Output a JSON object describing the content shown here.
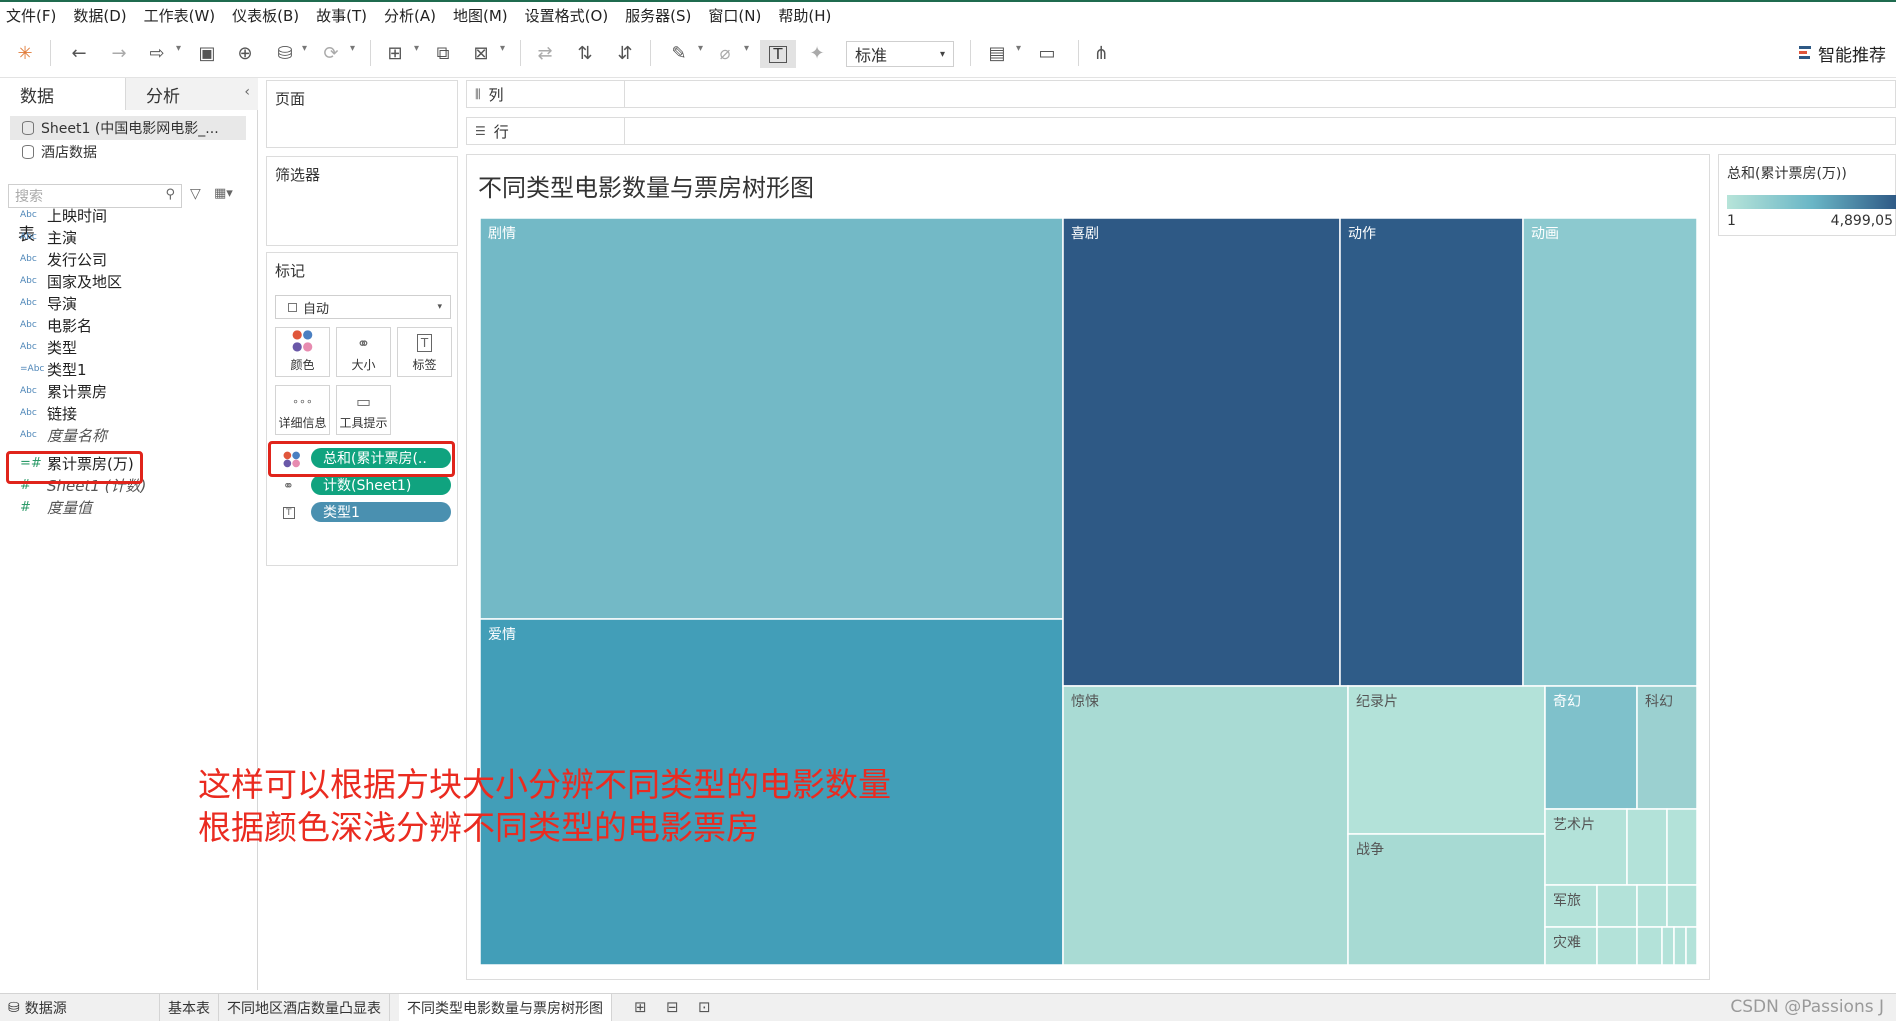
{
  "menu": [
    "文件(F)",
    "数据(D)",
    "工作表(W)",
    "仪表板(B)",
    "故事(T)",
    "分析(A)",
    "地图(M)",
    "设置格式(O)",
    "服务器(S)",
    "窗口(N)",
    "帮助(H)"
  ],
  "toolbar": {
    "fit_value": "标准",
    "smart_recommend": "智能推荐"
  },
  "data_pane": {
    "tab_data": "数据",
    "tab_analysis": "分析",
    "datasources": [
      "Sheet1 (中国电影网电影_...",
      "酒店数据"
    ],
    "search_placeholder": "搜索",
    "table_heading": "表",
    "dimensions": [
      {
        "type": "Abc",
        "label": "上映时间"
      },
      {
        "type": "Abc",
        "label": "主演"
      },
      {
        "type": "Abc",
        "label": "发行公司"
      },
      {
        "type": "Abc",
        "label": "国家及地区"
      },
      {
        "type": "Abc",
        "label": "导演"
      },
      {
        "type": "Abc",
        "label": "电影名"
      },
      {
        "type": "Abc",
        "label": "类型"
      },
      {
        "type": "=Abc",
        "label": "类型1"
      },
      {
        "type": "Abc",
        "label": "累计票房"
      },
      {
        "type": "Abc",
        "label": "链接"
      },
      {
        "type": "Abc",
        "label": "度量名称"
      }
    ],
    "measures": [
      {
        "type": "=#",
        "label": "累计票房(万)"
      },
      {
        "type": "#",
        "label": "Sheet1 (计数)"
      },
      {
        "type": "#",
        "label": "度量值"
      }
    ]
  },
  "cards": {
    "pages": "页面",
    "filters": "筛选器",
    "marks": "标记",
    "mark_type": "自动",
    "buttons": [
      "颜色",
      "大小",
      "标签",
      "详细信息",
      "工具提示"
    ],
    "pills": [
      {
        "label": "总和(累计票房(..",
        "color": "#10a37f"
      },
      {
        "label": "计数(Sheet1)",
        "color": "#10a37f"
      },
      {
        "label": "类型1",
        "color": "#4a90b0"
      }
    ]
  },
  "shelves": {
    "columns": "列",
    "rows": "行"
  },
  "view": {
    "title": "不同类型电影数量与票房树形图"
  },
  "chart_data": {
    "type": "treemap",
    "title": "不同类型电影数量与票房树形图",
    "size_measure": "计数(Sheet1)",
    "color_measure": "总和(累计票房(万))",
    "label_field": "类型1",
    "tiles": [
      {
        "label": "剧情",
        "count": 108,
        "color": "#73b9c6"
      },
      {
        "label": "爱情",
        "count": 68,
        "color": "#429eb8"
      },
      {
        "label": "喜剧",
        "count": 66,
        "color": "#2e5985"
      },
      {
        "label": "动作",
        "count": 48,
        "color": "#2f5c88"
      },
      {
        "label": "动画",
        "count": 38,
        "color": "#8cc9cf"
      },
      {
        "label": "惊悚",
        "count": 35,
        "color": "#a9dbd4"
      },
      {
        "label": "纪录片",
        "count": 12,
        "color": "#b3e2d9"
      },
      {
        "label": "战争",
        "count": 10,
        "color": "#a7dad3"
      },
      {
        "label": "奇幻",
        "count": 6,
        "color": "#7fc1cb"
      },
      {
        "label": "科幻",
        "count": 4,
        "color": "#9bd0d0"
      },
      {
        "label": "艺术片",
        "count": 3,
        "color": "#b3e2d9"
      },
      {
        "label": "军旅",
        "count": 2,
        "color": "#b3e2d9"
      },
      {
        "label": "灾难",
        "count": 2,
        "color": "#b3e2d9"
      }
    ],
    "legend_min": "1",
    "legend_max": "4,899,05"
  },
  "legend": {
    "title": "总和(累计票房(万))",
    "min": "1",
    "max": "4,899,05"
  },
  "annotation": {
    "line1": "这样可以根据方块大小分辨不同类型的电影数量",
    "line2": "根据颜色深浅分辨不同类型的电影票房"
  },
  "status": {
    "datasource": "数据源",
    "sheets": [
      "基本表",
      "不同地区酒店数量凸显表",
      "不同类型电影数量与票房树形图"
    ],
    "watermark": "CSDN @Passions J"
  }
}
